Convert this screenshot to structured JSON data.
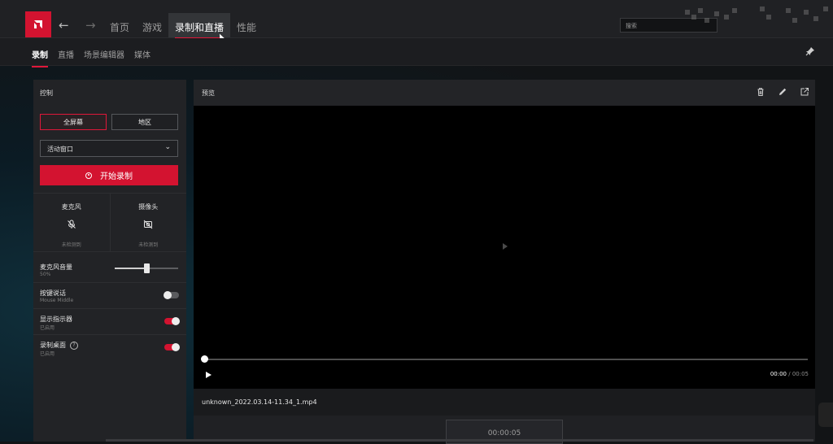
{
  "brand": {
    "accent": "#d31330",
    "logo_icon": "amd-logo-icon"
  },
  "topnav": {
    "back_icon": "arrow-left-icon",
    "forward_icon": "arrow-right-icon",
    "items": [
      {
        "label": "首页",
        "active": false
      },
      {
        "label": "游戏",
        "active": false
      },
      {
        "label": "录制和直播",
        "active": true
      },
      {
        "label": "性能",
        "active": false
      }
    ],
    "search_placeholder": "搜索"
  },
  "subnav": {
    "items": [
      {
        "label": "录制",
        "active": true
      },
      {
        "label": "直播",
        "active": false
      },
      {
        "label": "场景编辑器",
        "active": false
      },
      {
        "label": "媒体",
        "active": false
      }
    ],
    "pin_icon": "pin-icon"
  },
  "control_panel": {
    "title": "控制",
    "mode_buttons": [
      {
        "label": "全屏幕",
        "selected": true
      },
      {
        "label": "地区",
        "selected": false
      }
    ],
    "window_select": {
      "value": "活动窗口"
    },
    "record_button": {
      "label": "开始录制"
    },
    "devices": [
      {
        "name": "麦克风",
        "icon": "microphone-off-icon",
        "status": "未检测到"
      },
      {
        "name": "摄像头",
        "icon": "camera-off-icon",
        "status": "未检测到"
      }
    ],
    "settings": {
      "mic_volume": {
        "label": "麦克风音量",
        "value_text": "50%",
        "value": 0.5
      },
      "push_to_talk": {
        "label": "按键说话",
        "sub": "Mouse Middle",
        "enabled": false
      },
      "show_indicator": {
        "label": "显示指示器",
        "sub": "已启用",
        "enabled": true
      },
      "record_desktop": {
        "label": "录制桌面",
        "sub": "已启用",
        "enabled": true,
        "help_icon": "help-circle-icon"
      }
    }
  },
  "preview": {
    "title": "预览",
    "icons": [
      "trash-icon",
      "edit-icon",
      "share-icon"
    ],
    "current_time": "00:00",
    "total_time": "/ 00:05",
    "progress": 0.0,
    "file_name": "unknown_2022.03.14-11.34_1.mp4",
    "timecode": "00:00:05"
  }
}
